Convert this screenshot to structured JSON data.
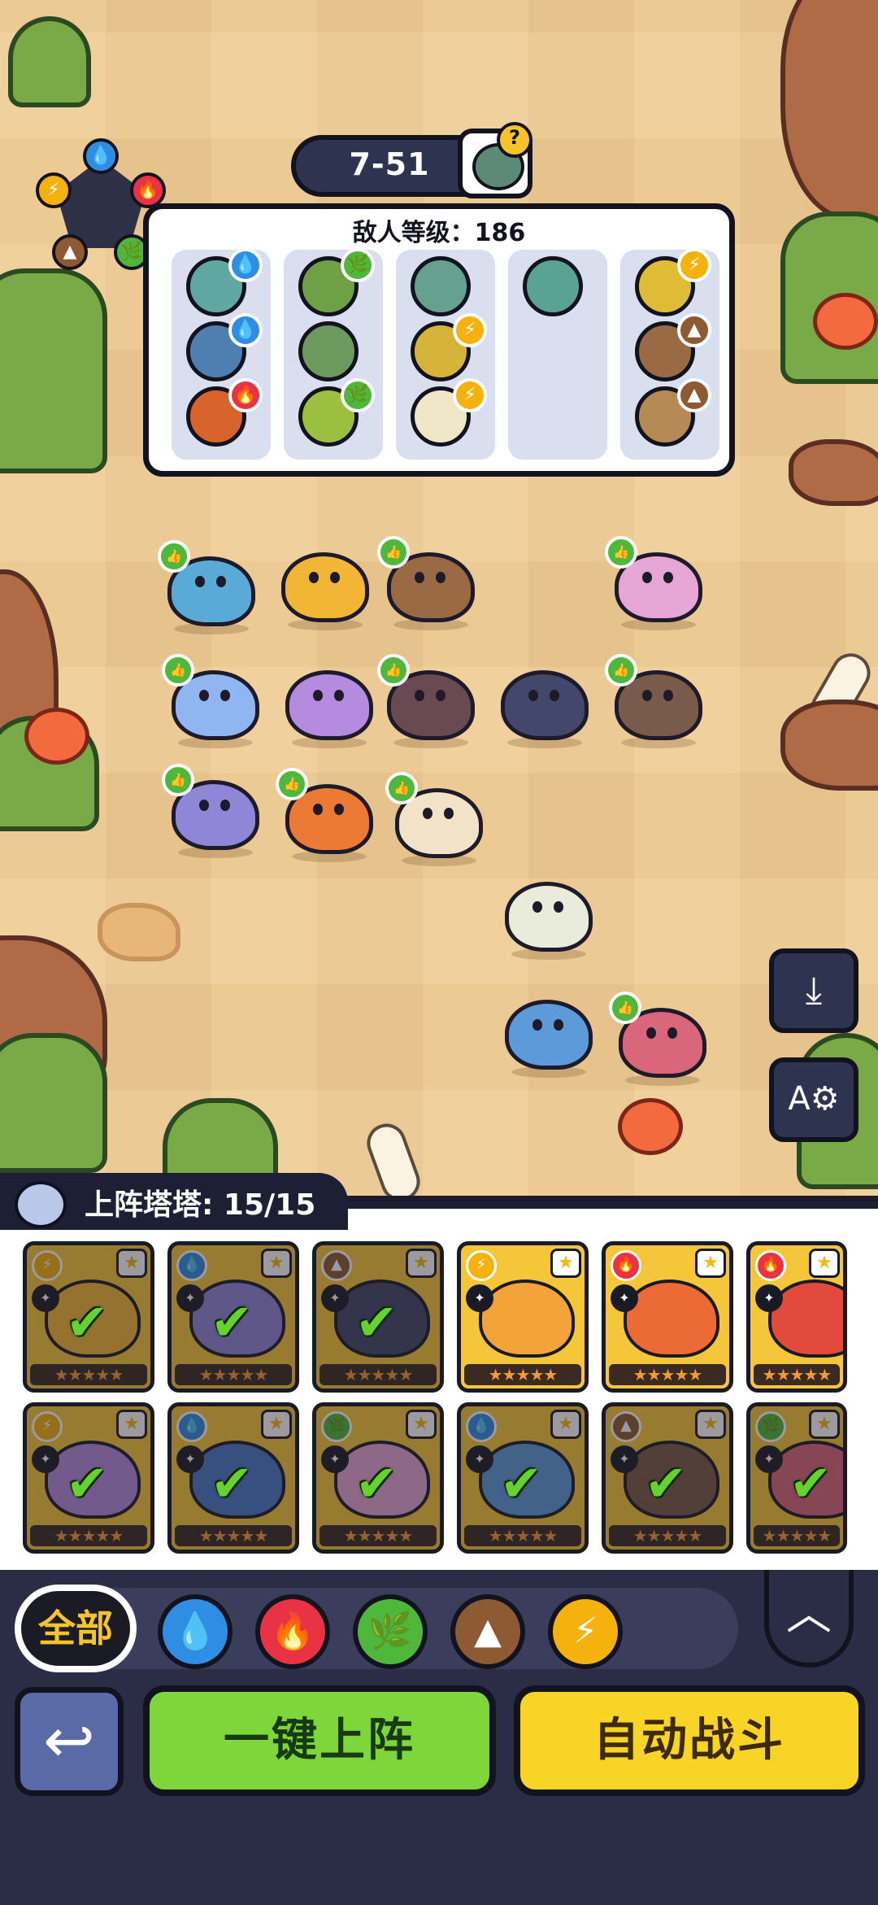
{
  "stage": {
    "label": "7-51"
  },
  "enemy_panel": {
    "title": "敌人等级：186",
    "columns": [
      [
        {
          "color": "#5fa7a0",
          "element": "water"
        },
        {
          "color": "#4f7fb0",
          "element": "water"
        },
        {
          "color": "#d8632d",
          "element": "fire"
        }
      ],
      [
        {
          "color": "#6ea146",
          "element": "leaf"
        },
        {
          "color": "#6d9a5f",
          "element": "none"
        },
        {
          "color": "#9bbf3e",
          "element": "leaf"
        }
      ],
      [
        {
          "color": "#66a08f",
          "element": "none"
        },
        {
          "color": "#d6b43a",
          "element": "bolt"
        },
        {
          "color": "#efe7c7",
          "element": "bolt"
        }
      ],
      [
        {
          "color": "#5aa293",
          "element": "none"
        }
      ],
      [
        {
          "color": "#e0bb36",
          "element": "bolt"
        },
        {
          "color": "#9a6a45",
          "element": "rock"
        },
        {
          "color": "#b58a55",
          "element": "rock"
        }
      ]
    ]
  },
  "element_wheel": [
    "water",
    "fire",
    "leaf",
    "rock",
    "bolt"
  ],
  "element_colors": {
    "water": "#2f8de4",
    "fire": "#ea3245",
    "leaf": "#4fb83c",
    "rock": "#8d5a34",
    "bolt": "#f5b10d"
  },
  "element_glyphs": {
    "water": "💧",
    "fire": "🔥",
    "leaf": "🌿",
    "rock": "▲",
    "bolt": "⚡",
    "none": ""
  },
  "side_buttons": [
    {
      "name": "download-icon",
      "glyph": "⤓"
    },
    {
      "name": "auto-settings-icon",
      "glyph": "A⚙"
    }
  ],
  "roster": {
    "label": "上阵塔塔: 15/15"
  },
  "cards_row1": [
    {
      "element": "bolt",
      "art": "#f2b637",
      "deployed": true
    },
    {
      "element": "water",
      "art": "#8f86d8",
      "deployed": true
    },
    {
      "element": "rock",
      "art": "#43476b",
      "deployed": true
    },
    {
      "element": "bolt",
      "art": "#f3a33a",
      "deployed": false
    },
    {
      "element": "fire",
      "art": "#ec6a35",
      "deployed": false
    },
    {
      "element": "fire",
      "art": "#e24a3b",
      "deployed": false
    }
  ],
  "cards_row2": [
    {
      "element": "bolt",
      "art": "#b58be0",
      "deployed": true
    },
    {
      "element": "water",
      "art": "#4a78c8",
      "deployed": true
    },
    {
      "element": "leaf",
      "art": "#e6a7d6",
      "deployed": true
    },
    {
      "element": "water",
      "art": "#5c9ad9",
      "deployed": true
    },
    {
      "element": "rock",
      "art": "#7a5a4a",
      "deployed": true
    },
    {
      "element": "leaf",
      "art": "#d9667a",
      "deployed": true
    }
  ],
  "filter": {
    "all_label": "全部",
    "elements": [
      "water",
      "fire",
      "leaf",
      "rock",
      "bolt"
    ]
  },
  "actions": {
    "deploy_label": "一键上阵",
    "auto_battle_label": "自动战斗"
  }
}
